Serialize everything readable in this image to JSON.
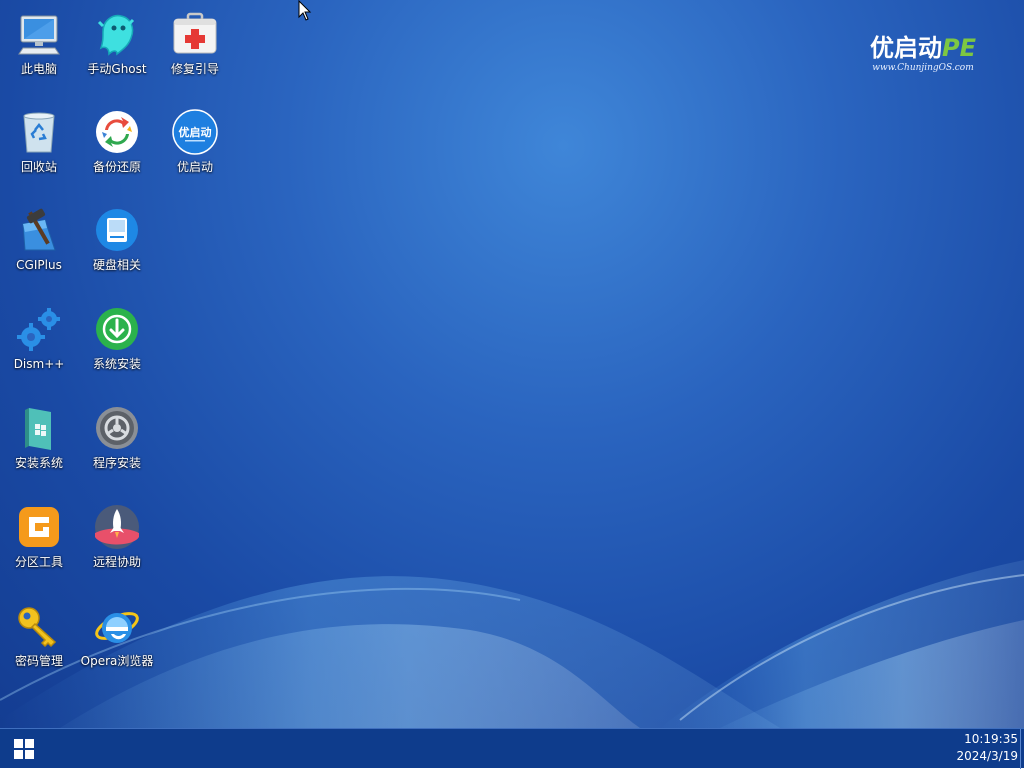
{
  "desktop": {
    "logo": {
      "main": "优启动",
      "suffix": "PE",
      "url": "www.ChunjingOS.com"
    },
    "icons": [
      {
        "label": "此电脑",
        "icon": "computer-icon"
      },
      {
        "label": "手动Ghost",
        "icon": "ghost-icon"
      },
      {
        "label": "修复引导",
        "icon": "first-aid-kit-icon"
      },
      {
        "label": "回收站",
        "icon": "recycle-bin-icon"
      },
      {
        "label": "备份还原",
        "icon": "backup-restore-icon"
      },
      {
        "label": "优启动",
        "icon": "youqidong-icon"
      },
      {
        "label": "CGIPlus",
        "icon": "hammer-icon"
      },
      {
        "label": "硬盘相关",
        "icon": "disk-icon"
      },
      {
        "label": "Dism++",
        "icon": "gears-icon"
      },
      {
        "label": "系统安装",
        "icon": "install-download-icon"
      },
      {
        "label": "安装系统",
        "icon": "windows-box-icon"
      },
      {
        "label": "程序安装",
        "icon": "program-gear-icon"
      },
      {
        "label": "分区工具",
        "icon": "partition-tool-icon"
      },
      {
        "label": "远程协助",
        "icon": "rocket-icon"
      },
      {
        "label": "密码管理",
        "icon": "key-icon"
      },
      {
        "label": "Opera浏览器",
        "icon": "ie-browser-icon"
      }
    ]
  },
  "taskbar": {
    "start_icon": "windows-logo-icon",
    "clock": {
      "time": "10:19:35",
      "date": "2024/3/19"
    }
  },
  "colors": {
    "desktop_bg": "#2a64bf",
    "taskbar_bg": "#0e3c8c",
    "logo_accent": "#7dc742"
  }
}
